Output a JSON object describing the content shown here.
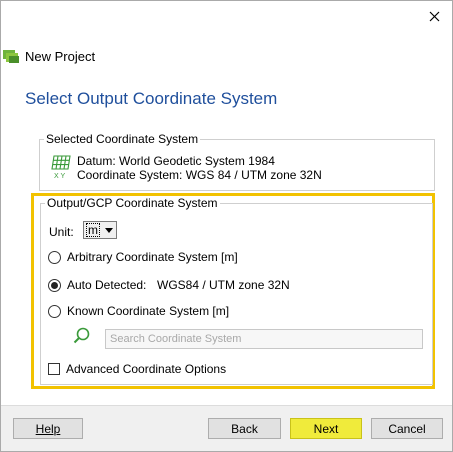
{
  "window": {
    "title": "New Project",
    "close_icon": "close-icon",
    "app_icon": "pix4d-app-icon"
  },
  "page": {
    "heading": "Select Output Coordinate System"
  },
  "selected_cs": {
    "legend": "Selected Coordinate System",
    "icon": "globe-grid-icon",
    "datum": "Datum: World Geodetic System 1984",
    "coordinate_system": "Coordinate System: WGS 84 / UTM zone 32N"
  },
  "output_cs": {
    "legend": "Output/GCP Coordinate System",
    "highlight_color": "#f2c200",
    "unit_label": "Unit:",
    "unit_value": "m",
    "options": [
      {
        "label": "Arbitrary Coordinate System [m]",
        "selected": false
      },
      {
        "label": "Auto Detected:",
        "selected": true,
        "value": "WGS84 / UTM zone 32N"
      },
      {
        "label": "Known Coordinate System [m]",
        "selected": false
      }
    ],
    "search_placeholder": "Search Coordinate System",
    "advanced_label": "Advanced Coordinate Options",
    "advanced_checked": false
  },
  "footer": {
    "help": "Help",
    "back": "Back",
    "next": "Next",
    "cancel": "Cancel",
    "next_color": "#f0eb3b"
  }
}
